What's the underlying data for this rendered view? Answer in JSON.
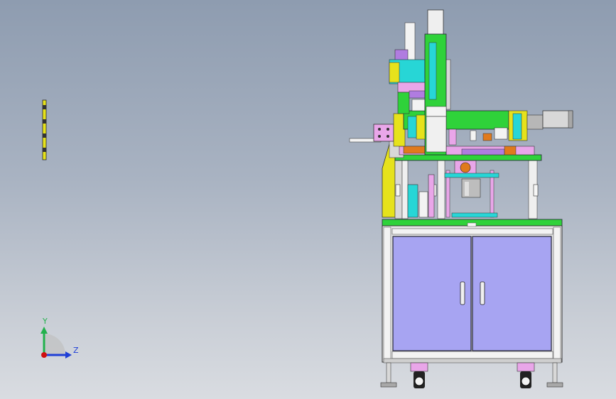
{
  "triad": {
    "y_label": "Y",
    "z_label": "Z",
    "y_color": "#22b14c",
    "z_color": "#1f3fd6",
    "x_color": "#d01010"
  },
  "colors": {
    "green": "#2fd23a",
    "yellow": "#e6e21c",
    "cabinet": "#a7a4f2",
    "frame": "#e7e7e7",
    "cyan": "#27d6d6",
    "pink": "#e9a6e9",
    "purple": "#b07ce0",
    "orange": "#e07a1c"
  }
}
